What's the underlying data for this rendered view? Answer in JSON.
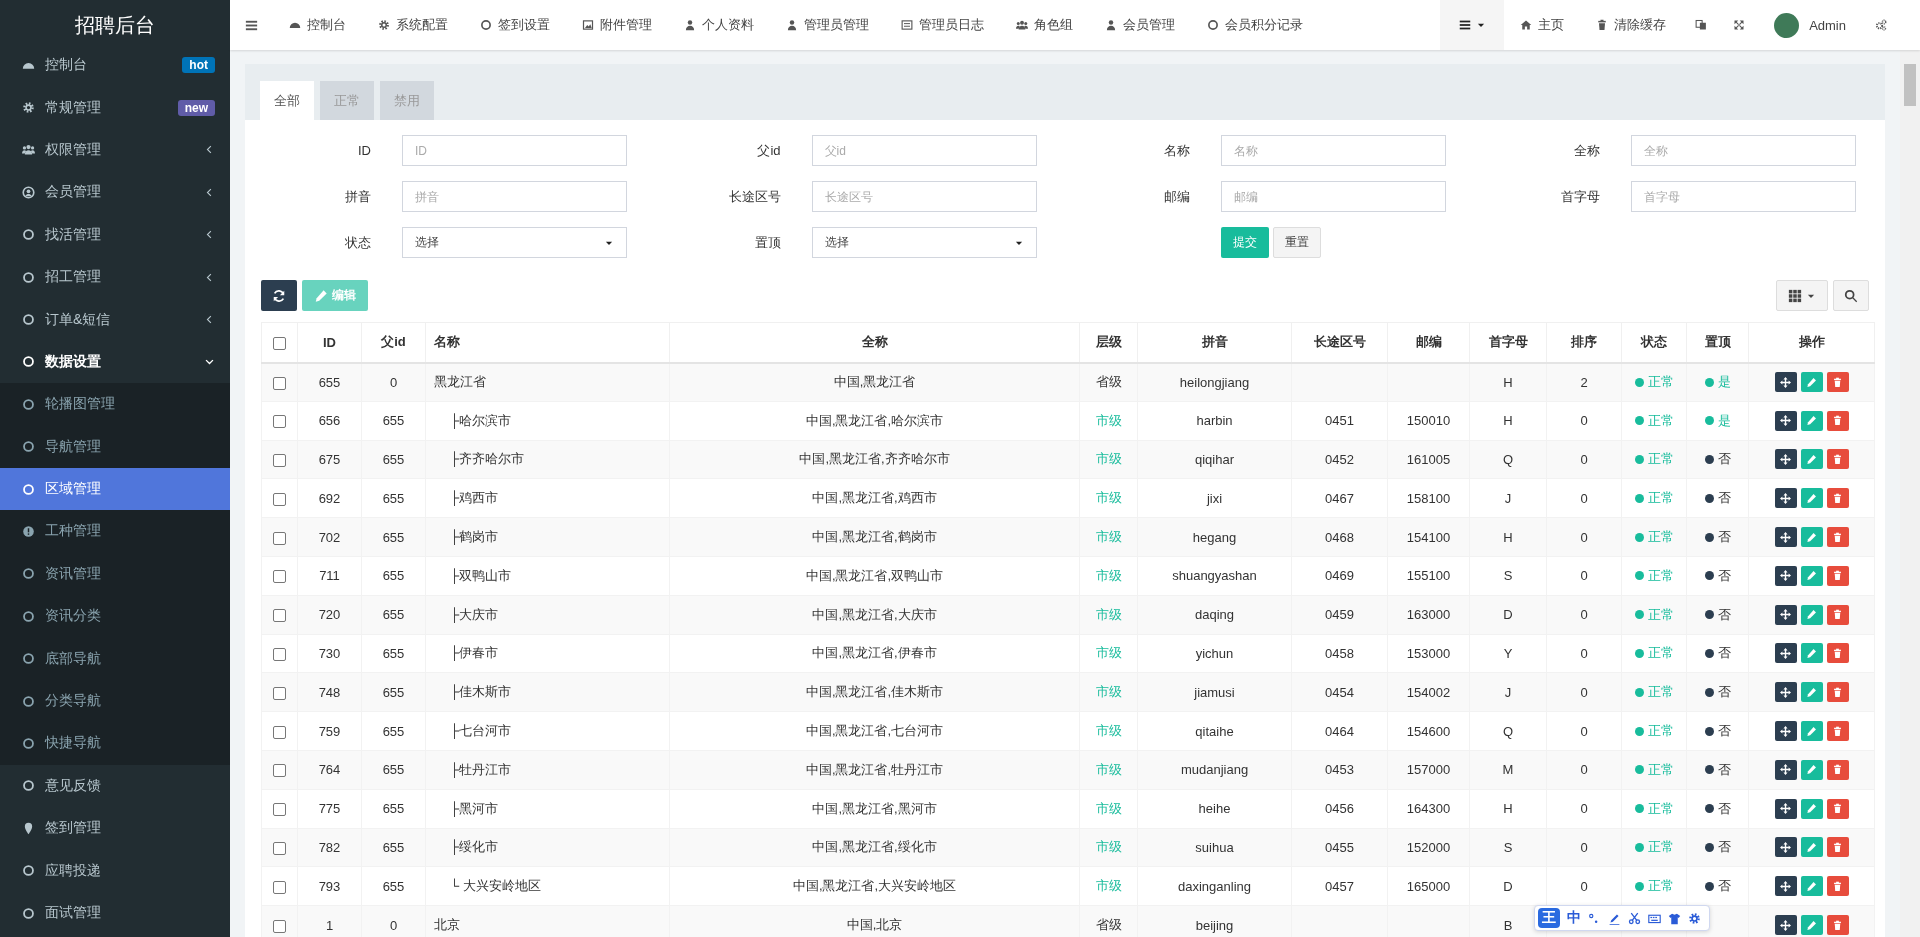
{
  "sidebar": {
    "title": "招聘后台",
    "items": [
      {
        "label": "控制台",
        "kind": "link",
        "selected": false,
        "badge": {
          "text": "hot",
          "color": "#0073b7"
        }
      },
      {
        "label": "常规管理",
        "kind": "link",
        "selected": false,
        "badge": {
          "text": "new",
          "color": "#605ca8"
        }
      },
      {
        "label": "权限管理",
        "kind": "group",
        "selected": false,
        "expanded": false
      },
      {
        "label": "会员管理",
        "kind": "group",
        "selected": false,
        "expanded": false
      },
      {
        "label": "找活管理",
        "kind": "group",
        "selected": false,
        "expanded": false
      },
      {
        "label": "招工管理",
        "kind": "group",
        "selected": false,
        "expanded": false
      },
      {
        "label": "订单&短信",
        "kind": "group",
        "selected": false,
        "expanded": false
      },
      {
        "label": "数据设置",
        "kind": "group",
        "selected": false,
        "expanded": true,
        "children": [
          {
            "label": "轮播图管理",
            "selected": false
          },
          {
            "label": "导航管理",
            "selected": false
          },
          {
            "label": "区域管理",
            "selected": true
          },
          {
            "label": "工种管理",
            "selected": false
          },
          {
            "label": "资讯管理",
            "selected": false
          },
          {
            "label": "资讯分类",
            "selected": false
          },
          {
            "label": "底部导航",
            "selected": false
          },
          {
            "label": "分类导航",
            "selected": false
          },
          {
            "label": "快捷导航",
            "selected": false
          }
        ]
      },
      {
        "label": "意见反馈",
        "kind": "link",
        "selected": false
      },
      {
        "label": "签到管理",
        "kind": "link",
        "selected": false
      },
      {
        "label": "应聘投递",
        "kind": "link",
        "selected": false
      },
      {
        "label": "面试管理",
        "kind": "link",
        "selected": false
      }
    ]
  },
  "topnav": {
    "items": [
      "控制台",
      "系统配置",
      "签到设置",
      "附件管理",
      "个人资料",
      "管理员管理",
      "管理员日志",
      "角色组",
      "会员管理",
      "会员积分记录"
    ],
    "right": [
      {
        "kind": "dropdown"
      },
      {
        "kind": "link",
        "label": "主页"
      },
      {
        "kind": "link",
        "label": "清除缓存"
      },
      {
        "kind": "icon"
      },
      {
        "kind": "icon"
      },
      {
        "kind": "user",
        "label": "Admin"
      },
      {
        "kind": "icon"
      }
    ]
  },
  "tabs": [
    {
      "label": "全部",
      "selected": true
    },
    {
      "label": "正常",
      "selected": false
    },
    {
      "label": "禁用",
      "selected": false
    }
  ],
  "filters": [
    {
      "label": "ID",
      "kind": "text",
      "placeholder": "ID"
    },
    {
      "label": "父id",
      "kind": "text",
      "placeholder": "父id"
    },
    {
      "label": "名称",
      "kind": "text",
      "placeholder": "名称"
    },
    {
      "label": "全称",
      "kind": "text",
      "placeholder": "全称"
    },
    {
      "label": "拼音",
      "kind": "text",
      "placeholder": "拼音"
    },
    {
      "label": "长途区号",
      "kind": "text",
      "placeholder": "长途区号"
    },
    {
      "label": "邮编",
      "kind": "text",
      "placeholder": "邮编"
    },
    {
      "label": "首字母",
      "kind": "text",
      "placeholder": "首字母"
    },
    {
      "label": "状态",
      "kind": "select",
      "value": "选择"
    },
    {
      "label": "置顶",
      "kind": "select",
      "value": "选择"
    }
  ],
  "filter_buttons": {
    "submit": "提交",
    "reset": "重置"
  },
  "toolbar": {
    "edit": {
      "label": "编辑",
      "disabled": true
    }
  },
  "table": {
    "select_all_checked": false,
    "columns": [
      "ID",
      "父id",
      "名称",
      "全称",
      "层级",
      "拼音",
      "长途区号",
      "邮编",
      "首字母",
      "排序",
      "状态",
      "置顶",
      "操作"
    ],
    "rows": [
      {
        "checked": false,
        "id": "655",
        "parent_id": "0",
        "name": "黑龙江省",
        "full_name": "中国,黑龙江省",
        "kind": "province",
        "tier": "省级",
        "pinyin": "heilongjiang",
        "initial": "H",
        "sort": "2",
        "status": {
          "text": "正常",
          "on": true
        },
        "pinned": {
          "text": "是",
          "on": true
        },
        "children": [
          {
            "checked": false,
            "id": "656",
            "parent_id": "655",
            "name": "├哈尔滨市",
            "full_name": "中国,黑龙江省,哈尔滨市",
            "kind": "city",
            "tier": "市级",
            "pinyin": "harbin",
            "area_code": "0451",
            "zip": "150010",
            "initial": "H",
            "sort": "0",
            "status": {
              "text": "正常",
              "on": true
            },
            "pinned": {
              "text": "是",
              "on": true
            }
          },
          {
            "checked": false,
            "id": "675",
            "parent_id": "655",
            "name": "├齐齐哈尔市",
            "full_name": "中国,黑龙江省,齐齐哈尔市",
            "kind": "city",
            "tier": "市级",
            "pinyin": "qiqihar",
            "area_code": "0452",
            "zip": "161005",
            "initial": "Q",
            "sort": "0",
            "status": {
              "text": "正常",
              "on": true
            },
            "pinned": {
              "text": "否",
              "on": false
            }
          },
          {
            "checked": false,
            "id": "692",
            "parent_id": "655",
            "name": "├鸡西市",
            "full_name": "中国,黑龙江省,鸡西市",
            "kind": "city",
            "tier": "市级",
            "pinyin": "jixi",
            "area_code": "0467",
            "zip": "158100",
            "initial": "J",
            "sort": "0",
            "status": {
              "text": "正常",
              "on": true
            },
            "pinned": {
              "text": "否",
              "on": false
            }
          },
          {
            "checked": false,
            "id": "702",
            "parent_id": "655",
            "name": "├鹤岗市",
            "full_name": "中国,黑龙江省,鹤岗市",
            "kind": "city",
            "tier": "市级",
            "pinyin": "hegang",
            "area_code": "0468",
            "zip": "154100",
            "initial": "H",
            "sort": "0",
            "status": {
              "text": "正常",
              "on": true
            },
            "pinned": {
              "text": "否",
              "on": false
            }
          },
          {
            "checked": false,
            "id": "711",
            "parent_id": "655",
            "name": "├双鸭山市",
            "full_name": "中国,黑龙江省,双鸭山市",
            "kind": "city",
            "tier": "市级",
            "pinyin": "shuangyashan",
            "area_code": "0469",
            "zip": "155100",
            "initial": "S",
            "sort": "0",
            "status": {
              "text": "正常",
              "on": true
            },
            "pinned": {
              "text": "否",
              "on": false
            }
          },
          {
            "checked": false,
            "id": "720",
            "parent_id": "655",
            "name": "├大庆市",
            "full_name": "中国,黑龙江省,大庆市",
            "kind": "city",
            "tier": "市级",
            "pinyin": "daqing",
            "area_code": "0459",
            "zip": "163000",
            "initial": "D",
            "sort": "0",
            "status": {
              "text": "正常",
              "on": true
            },
            "pinned": {
              "text": "否",
              "on": false
            }
          },
          {
            "checked": false,
            "id": "730",
            "parent_id": "655",
            "name": "├伊春市",
            "full_name": "中国,黑龙江省,伊春市",
            "kind": "city",
            "tier": "市级",
            "pinyin": "yichun",
            "area_code": "0458",
            "zip": "153000",
            "initial": "Y",
            "sort": "0",
            "status": {
              "text": "正常",
              "on": true
            },
            "pinned": {
              "text": "否",
              "on": false
            }
          },
          {
            "checked": false,
            "id": "748",
            "parent_id": "655",
            "name": "├佳木斯市",
            "full_name": "中国,黑龙江省,佳木斯市",
            "kind": "city",
            "tier": "市级",
            "pinyin": "jiamusi",
            "area_code": "0454",
            "zip": "154002",
            "initial": "J",
            "sort": "0",
            "status": {
              "text": "正常",
              "on": true
            },
            "pinned": {
              "text": "否",
              "on": false
            }
          },
          {
            "checked": false,
            "id": "759",
            "parent_id": "655",
            "name": "├七台河市",
            "full_name": "中国,黑龙江省,七台河市",
            "kind": "city",
            "tier": "市级",
            "pinyin": "qitaihe",
            "area_code": "0464",
            "zip": "154600",
            "initial": "Q",
            "sort": "0",
            "status": {
              "text": "正常",
              "on": true
            },
            "pinned": {
              "text": "否",
              "on": false
            }
          },
          {
            "checked": false,
            "id": "764",
            "parent_id": "655",
            "name": "├牡丹江市",
            "full_name": "中国,黑龙江省,牡丹江市",
            "kind": "city",
            "tier": "市级",
            "pinyin": "mudanjiang",
            "area_code": "0453",
            "zip": "157000",
            "initial": "M",
            "sort": "0",
            "status": {
              "text": "正常",
              "on": true
            },
            "pinned": {
              "text": "否",
              "on": false
            }
          },
          {
            "checked": false,
            "id": "775",
            "parent_id": "655",
            "name": "├黑河市",
            "full_name": "中国,黑龙江省,黑河市",
            "kind": "city",
            "tier": "市级",
            "pinyin": "heihe",
            "area_code": "0456",
            "zip": "164300",
            "initial": "H",
            "sort": "0",
            "status": {
              "text": "正常",
              "on": true
            },
            "pinned": {
              "text": "否",
              "on": false
            }
          },
          {
            "checked": false,
            "id": "782",
            "parent_id": "655",
            "name": "├绥化市",
            "full_name": "中国,黑龙江省,绥化市",
            "kind": "city",
            "tier": "市级",
            "pinyin": "suihua",
            "area_code": "0455",
            "zip": "152000",
            "initial": "S",
            "sort": "0",
            "status": {
              "text": "正常",
              "on": true
            },
            "pinned": {
              "text": "否",
              "on": false
            }
          },
          {
            "checked": false,
            "id": "793",
            "parent_id": "655",
            "name": "└ 大兴安岭地区",
            "full_name": "中国,黑龙江省,大兴安岭地区",
            "kind": "city",
            "tier": "市级",
            "pinyin": "daxinganling",
            "area_code": "0457",
            "zip": "165000",
            "initial": "D",
            "sort": "0",
            "status": {
              "text": "正常",
              "on": true
            },
            "pinned": {
              "text": "否",
              "on": false
            }
          }
        ]
      },
      {
        "checked": false,
        "id": "1",
        "parent_id": "0",
        "name": "北京",
        "full_name": "中国,北京",
        "kind": "province",
        "tier": "省级",
        "pinyin": "beijing",
        "initial": "B"
      }
    ]
  },
  "ime_toolbar": {
    "logo": "王",
    "mode": "中"
  }
}
